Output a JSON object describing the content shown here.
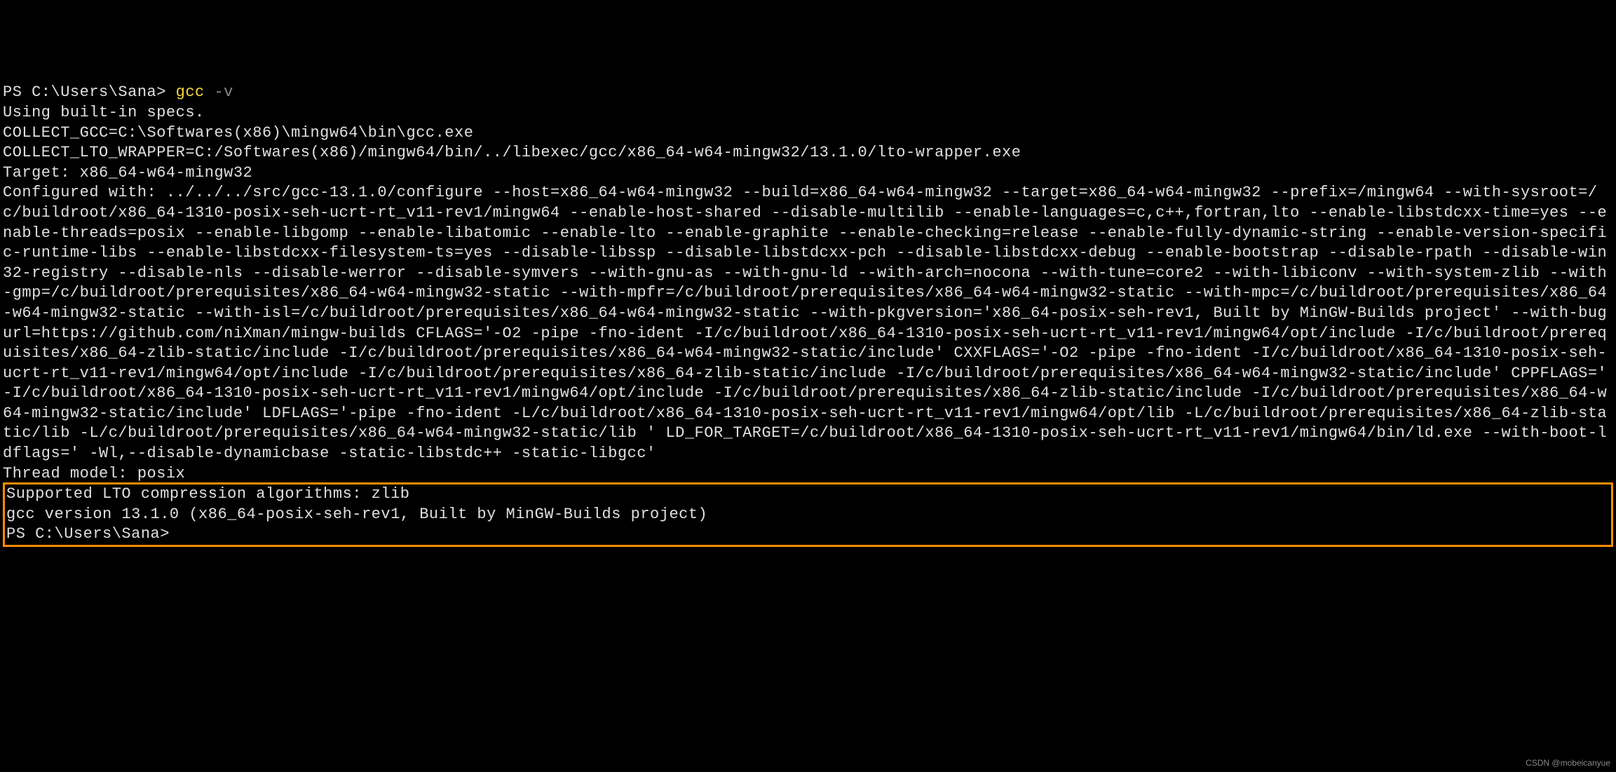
{
  "prompt1_ps": "PS ",
  "prompt1_path": "C:\\Users\\Sana> ",
  "cmd_gcc": "gcc",
  "cmd_space": " ",
  "cmd_flag": "-v",
  "output_line1": "Using built-in specs.",
  "output_line2": "COLLECT_GCC=C:\\Softwares(x86)\\mingw64\\bin\\gcc.exe",
  "output_line3": "COLLECT_LTO_WRAPPER=C:/Softwares(x86)/mingw64/bin/../libexec/gcc/x86_64-w64-mingw32/13.1.0/lto-wrapper.exe",
  "output_line4": "Target: x86_64-w64-mingw32",
  "output_config": "Configured with: ../../../src/gcc-13.1.0/configure --host=x86_64-w64-mingw32 --build=x86_64-w64-mingw32 --target=x86_64-w64-mingw32 --prefix=/mingw64 --with-sysroot=/c/buildroot/x86_64-1310-posix-seh-ucrt-rt_v11-rev1/mingw64 --enable-host-shared --disable-multilib --enable-languages=c,c++,fortran,lto --enable-libstdcxx-time=yes --enable-threads=posix --enable-libgomp --enable-libatomic --enable-lto --enable-graphite --enable-checking=release --enable-fully-dynamic-string --enable-version-specific-runtime-libs --enable-libstdcxx-filesystem-ts=yes --disable-libssp --disable-libstdcxx-pch --disable-libstdcxx-debug --enable-bootstrap --disable-rpath --disable-win32-registry --disable-nls --disable-werror --disable-symvers --with-gnu-as --with-gnu-ld --with-arch=nocona --with-tune=core2 --with-libiconv --with-system-zlib --with-gmp=/c/buildroot/prerequisites/x86_64-w64-mingw32-static --with-mpfr=/c/buildroot/prerequisites/x86_64-w64-mingw32-static --with-mpc=/c/buildroot/prerequisites/x86_64-w64-mingw32-static --with-isl=/c/buildroot/prerequisites/x86_64-w64-mingw32-static --with-pkgversion='x86_64-posix-seh-rev1, Built by MinGW-Builds project' --with-bugurl=https://github.com/niXman/mingw-builds CFLAGS='-O2 -pipe -fno-ident -I/c/buildroot/x86_64-1310-posix-seh-ucrt-rt_v11-rev1/mingw64/opt/include -I/c/buildroot/prerequisites/x86_64-zlib-static/include -I/c/buildroot/prerequisites/x86_64-w64-mingw32-static/include' CXXFLAGS='-O2 -pipe -fno-ident -I/c/buildroot/x86_64-1310-posix-seh-ucrt-rt_v11-rev1/mingw64/opt/include -I/c/buildroot/prerequisites/x86_64-zlib-static/include -I/c/buildroot/prerequisites/x86_64-w64-mingw32-static/include' CPPFLAGS=' -I/c/buildroot/x86_64-1310-posix-seh-ucrt-rt_v11-rev1/mingw64/opt/include -I/c/buildroot/prerequisites/x86_64-zlib-static/include -I/c/buildroot/prerequisites/x86_64-w64-mingw32-static/include' LDFLAGS='-pipe -fno-ident -L/c/buildroot/x86_64-1310-posix-seh-ucrt-rt_v11-rev1/mingw64/opt/lib -L/c/buildroot/prerequisites/x86_64-zlib-static/lib -L/c/buildroot/prerequisites/x86_64-w64-mingw32-static/lib ' LD_FOR_TARGET=/c/buildroot/x86_64-1310-posix-seh-ucrt-rt_v11-rev1/mingw64/bin/ld.exe --with-boot-ldflags=' -Wl,--disable-dynamicbase -static-libstdc++ -static-libgcc'",
  "output_thread": "Thread model: posix",
  "highlight_line1": "Supported LTO compression algorithms: zlib",
  "highlight_line2": "gcc version 13.1.0 (x86_64-posix-seh-rev1, Built by MinGW-Builds project) ",
  "prompt2_ps": "PS ",
  "prompt2_path": "C:\\Users\\Sana>",
  "watermark": "CSDN @mobeicanyue"
}
